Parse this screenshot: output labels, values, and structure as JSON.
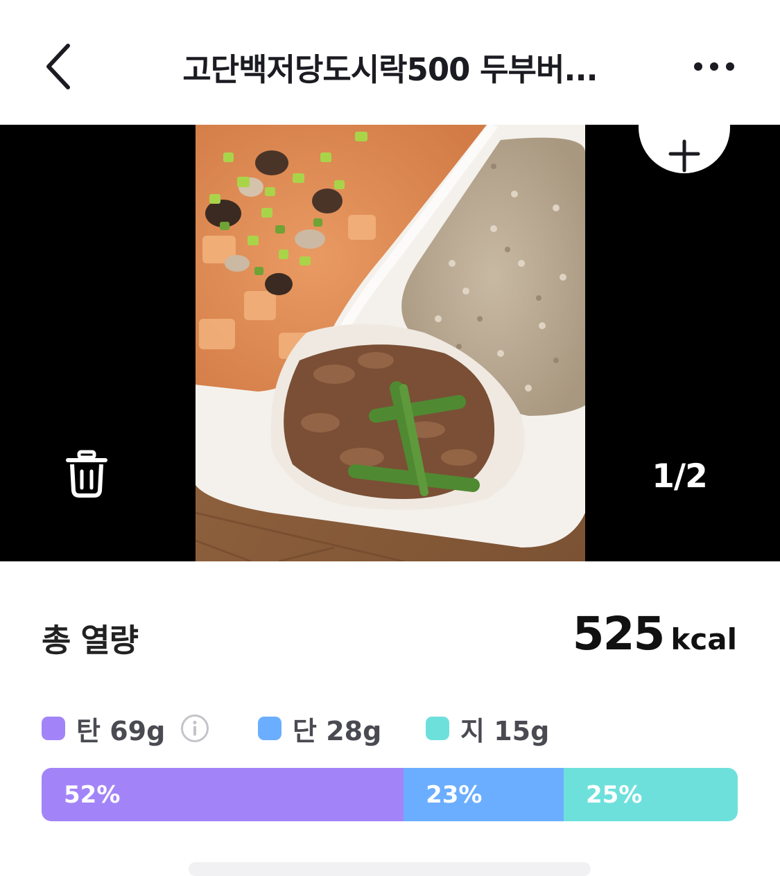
{
  "header": {
    "title": "고단백저당도시락500 두부버...",
    "back_icon": "chevron-left-icon",
    "more_icon": "more-horizontal-icon"
  },
  "photo": {
    "counter": "1/2",
    "add_icon": "plus-icon",
    "delete_icon": "trash-icon"
  },
  "summary": {
    "label": "총 열량",
    "kcal_value": "525",
    "kcal_unit": "kcal"
  },
  "macros": [
    {
      "name": "탄",
      "amount": "69g",
      "text": "탄 69g",
      "color": "#a384f8",
      "percent_label": "52%",
      "percent": 52
    },
    {
      "name": "단",
      "amount": "28g",
      "text": "단 28g",
      "color": "#6baeff",
      "percent_label": "23%",
      "percent": 23
    },
    {
      "name": "지",
      "amount": "15g",
      "text": "지 15g",
      "color": "#6ee0dc",
      "percent_label": "25%",
      "percent": 25
    }
  ],
  "info_icon": "info-icon",
  "colors": {
    "photo_background": "#000000",
    "text_primary": "#1a1a1f"
  }
}
